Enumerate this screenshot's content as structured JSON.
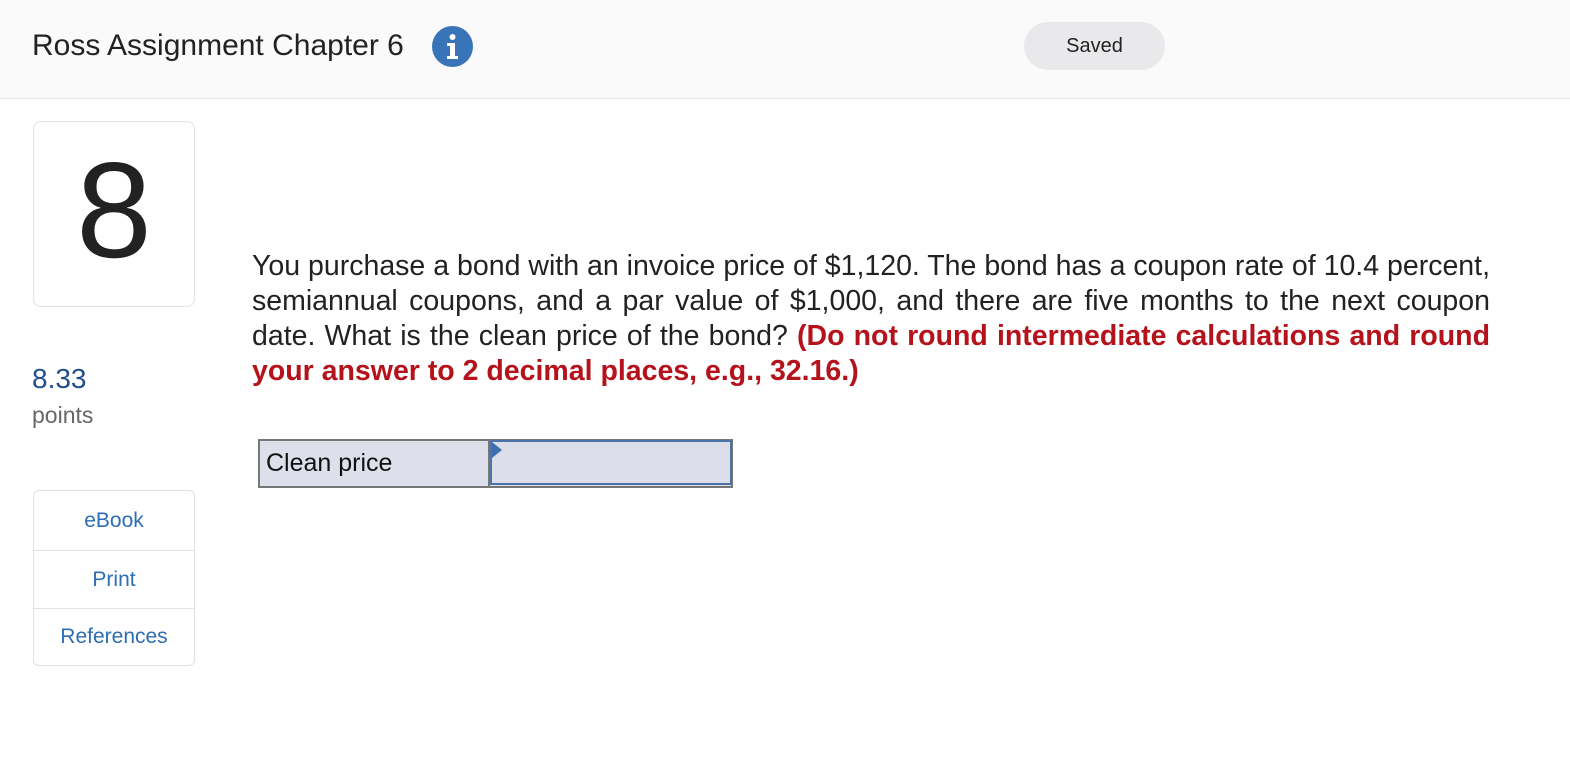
{
  "header": {
    "title": "Ross Assignment Chapter 6",
    "info_icon": "info-icon",
    "status": "Saved"
  },
  "question": {
    "number": "8",
    "points_value": "8.33",
    "points_label": "points",
    "text": "You purchase a bond with an invoice price of $1,120. The bond has a coupon rate of 10.4 percent, semiannual coupons, and a par value of $1,000, and there are five months to the next coupon date. What is the clean price of the bond? ",
    "instruction": "(Do not round intermediate calculations and round your answer to 2 decimal places, e.g., 32.16.)"
  },
  "tools": [
    {
      "label": "eBook"
    },
    {
      "label": "Print"
    },
    {
      "label": "References"
    }
  ],
  "answer": {
    "label": "Clean price",
    "value": ""
  },
  "colors": {
    "accent_blue": "#3a74b8",
    "link_blue": "#2c6db3",
    "points_blue": "#1f4e8c",
    "instruction_red": "#b5121b",
    "answer_bg": "#dde0ea"
  }
}
